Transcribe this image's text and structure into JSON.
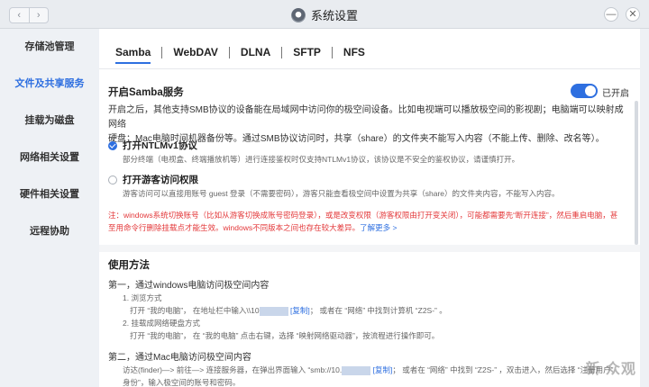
{
  "window": {
    "title": "系统设置",
    "nav_back": "‹",
    "nav_forward": "›",
    "btn_minimize": "—",
    "btn_close": "✕"
  },
  "sidebar": {
    "items": [
      {
        "label": "存储池管理",
        "active": false
      },
      {
        "label": "文件及共享服务",
        "active": true
      },
      {
        "label": "挂载为磁盘",
        "active": false
      },
      {
        "label": "网络相关设置",
        "active": false
      },
      {
        "label": "硬件相关设置",
        "active": false
      },
      {
        "label": "远程协助",
        "active": false
      }
    ]
  },
  "tabs": [
    "Samba",
    "WebDAV",
    "DLNA",
    "SFTP",
    "NFS"
  ],
  "samba": {
    "title": "开启Samba服务",
    "toggle_label": "已开启",
    "toggle_on": true,
    "desc_line1": "开启之后，其他支持SMB协议的设备能在局域网中访问你的极空间设备。比如电视端可以播放极空间的影视剧；电脑端可以映射成网络",
    "desc_line2": "硬盘；Mac电脑时间机器备份等。通过SMB协议访问时，共享（share）的文件夹不能写入内容（不能上传、删除、改名等）。",
    "ntlm_label": "打开NTLMv1协议",
    "ntlm_checked": true,
    "ntlm_desc": "部分终端（电视盒、终端播放机等）进行连接鉴权时仅支持NTLMv1协议，该协议是不安全的鉴权协议，请谨慎打开。",
    "guest_label": "打开游客访问权限",
    "guest_checked": false,
    "guest_desc": "游客访问可以直接用账号 guest 登录（不需要密码），游客只能查看极空间中设置为共享（share）的文件夹内容，不能写入内容。",
    "warn_line1": "注：windows系统切换账号（比如从游客切换成账号密码登录），或是改变权限（游客权限由打开变关闭），可能都需要先“断开连接”，然后重启电脑，甚",
    "warn_line2_a": "至用命令行删除挂载点才能生效。windows不同版本之间也存在较大差异。",
    "warn_link": "了解更多 >"
  },
  "usage": {
    "title": "使用方法",
    "step1_title": "第一，通过windows电脑访问极空间内容",
    "step1_a": "1. 浏览方式",
    "step1_a_detail_pre": "打开 “我的电脑”，  在地址栏中输入\\\\10",
    "step1_a_copy": "[复制]",
    "step1_a_detail_post": "；  或者在 “网络” 中找到计算机 “Z2S-” 。",
    "step1_b": "2. 挂载成网络硬盘方式",
    "step1_b_detail": "打开 “我的电脑”， 在 “我的电脑” 点击右键，选择 “映射网络驱动器”，按流程进行操作即可。",
    "step2_title": "第二，通过Mac电脑访问极空间内容",
    "step2_detail_pre": "访达(finder)—> 前往—> 连接服务器，在弹出界面输入 “smb://10.",
    "step2_copy": "[复制]",
    "step2_detail_post": "；  或者在 “网络” 中找到 “Z2S-” ，双击进入，然后选择 “注册用户”",
    "step2_detail_line2": "身份”，输入极空间的账号和密码。"
  },
  "watermark": "新 众观"
}
